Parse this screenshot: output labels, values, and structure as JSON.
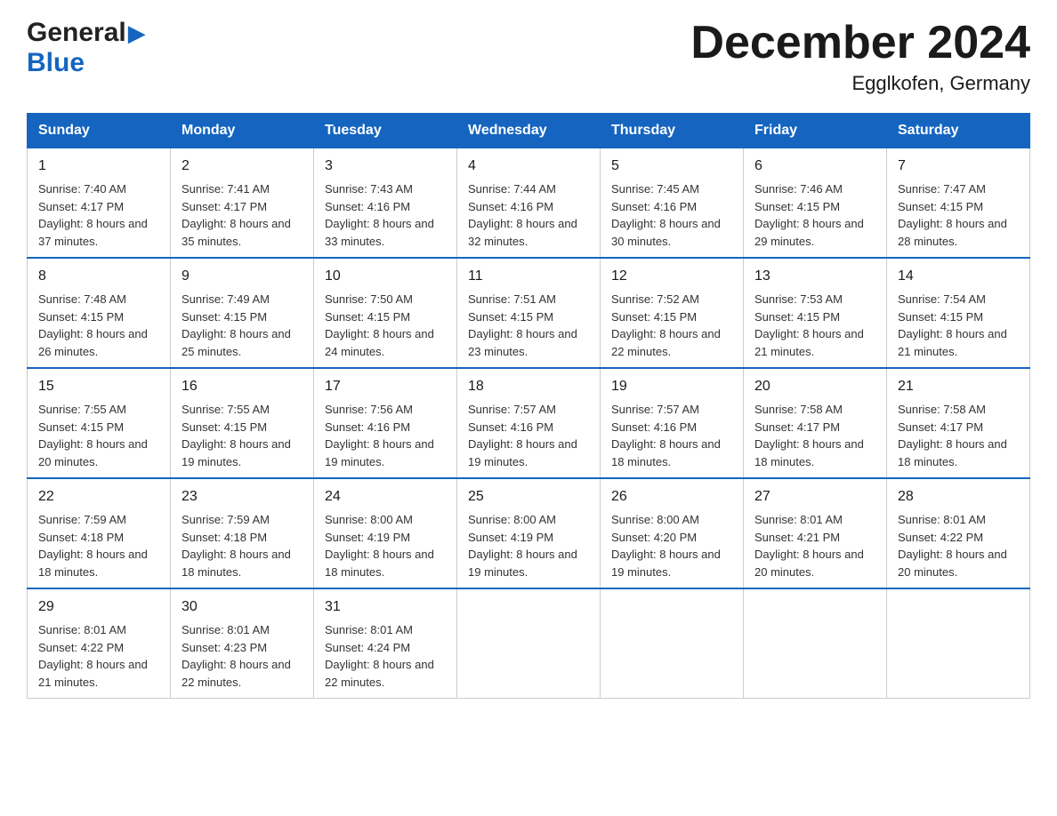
{
  "header": {
    "logo_general": "General",
    "logo_blue": "Blue",
    "month_title": "December 2024",
    "location": "Egglkofen, Germany"
  },
  "days_of_week": [
    "Sunday",
    "Monday",
    "Tuesday",
    "Wednesday",
    "Thursday",
    "Friday",
    "Saturday"
  ],
  "weeks": [
    [
      {
        "day": "1",
        "sunrise": "Sunrise: 7:40 AM",
        "sunset": "Sunset: 4:17 PM",
        "daylight": "Daylight: 8 hours and 37 minutes."
      },
      {
        "day": "2",
        "sunrise": "Sunrise: 7:41 AM",
        "sunset": "Sunset: 4:17 PM",
        "daylight": "Daylight: 8 hours and 35 minutes."
      },
      {
        "day": "3",
        "sunrise": "Sunrise: 7:43 AM",
        "sunset": "Sunset: 4:16 PM",
        "daylight": "Daylight: 8 hours and 33 minutes."
      },
      {
        "day": "4",
        "sunrise": "Sunrise: 7:44 AM",
        "sunset": "Sunset: 4:16 PM",
        "daylight": "Daylight: 8 hours and 32 minutes."
      },
      {
        "day": "5",
        "sunrise": "Sunrise: 7:45 AM",
        "sunset": "Sunset: 4:16 PM",
        "daylight": "Daylight: 8 hours and 30 minutes."
      },
      {
        "day": "6",
        "sunrise": "Sunrise: 7:46 AM",
        "sunset": "Sunset: 4:15 PM",
        "daylight": "Daylight: 8 hours and 29 minutes."
      },
      {
        "day": "7",
        "sunrise": "Sunrise: 7:47 AM",
        "sunset": "Sunset: 4:15 PM",
        "daylight": "Daylight: 8 hours and 28 minutes."
      }
    ],
    [
      {
        "day": "8",
        "sunrise": "Sunrise: 7:48 AM",
        "sunset": "Sunset: 4:15 PM",
        "daylight": "Daylight: 8 hours and 26 minutes."
      },
      {
        "day": "9",
        "sunrise": "Sunrise: 7:49 AM",
        "sunset": "Sunset: 4:15 PM",
        "daylight": "Daylight: 8 hours and 25 minutes."
      },
      {
        "day": "10",
        "sunrise": "Sunrise: 7:50 AM",
        "sunset": "Sunset: 4:15 PM",
        "daylight": "Daylight: 8 hours and 24 minutes."
      },
      {
        "day": "11",
        "sunrise": "Sunrise: 7:51 AM",
        "sunset": "Sunset: 4:15 PM",
        "daylight": "Daylight: 8 hours and 23 minutes."
      },
      {
        "day": "12",
        "sunrise": "Sunrise: 7:52 AM",
        "sunset": "Sunset: 4:15 PM",
        "daylight": "Daylight: 8 hours and 22 minutes."
      },
      {
        "day": "13",
        "sunrise": "Sunrise: 7:53 AM",
        "sunset": "Sunset: 4:15 PM",
        "daylight": "Daylight: 8 hours and 21 minutes."
      },
      {
        "day": "14",
        "sunrise": "Sunrise: 7:54 AM",
        "sunset": "Sunset: 4:15 PM",
        "daylight": "Daylight: 8 hours and 21 minutes."
      }
    ],
    [
      {
        "day": "15",
        "sunrise": "Sunrise: 7:55 AM",
        "sunset": "Sunset: 4:15 PM",
        "daylight": "Daylight: 8 hours and 20 minutes."
      },
      {
        "day": "16",
        "sunrise": "Sunrise: 7:55 AM",
        "sunset": "Sunset: 4:15 PM",
        "daylight": "Daylight: 8 hours and 19 minutes."
      },
      {
        "day": "17",
        "sunrise": "Sunrise: 7:56 AM",
        "sunset": "Sunset: 4:16 PM",
        "daylight": "Daylight: 8 hours and 19 minutes."
      },
      {
        "day": "18",
        "sunrise": "Sunrise: 7:57 AM",
        "sunset": "Sunset: 4:16 PM",
        "daylight": "Daylight: 8 hours and 19 minutes."
      },
      {
        "day": "19",
        "sunrise": "Sunrise: 7:57 AM",
        "sunset": "Sunset: 4:16 PM",
        "daylight": "Daylight: 8 hours and 18 minutes."
      },
      {
        "day": "20",
        "sunrise": "Sunrise: 7:58 AM",
        "sunset": "Sunset: 4:17 PM",
        "daylight": "Daylight: 8 hours and 18 minutes."
      },
      {
        "day": "21",
        "sunrise": "Sunrise: 7:58 AM",
        "sunset": "Sunset: 4:17 PM",
        "daylight": "Daylight: 8 hours and 18 minutes."
      }
    ],
    [
      {
        "day": "22",
        "sunrise": "Sunrise: 7:59 AM",
        "sunset": "Sunset: 4:18 PM",
        "daylight": "Daylight: 8 hours and 18 minutes."
      },
      {
        "day": "23",
        "sunrise": "Sunrise: 7:59 AM",
        "sunset": "Sunset: 4:18 PM",
        "daylight": "Daylight: 8 hours and 18 minutes."
      },
      {
        "day": "24",
        "sunrise": "Sunrise: 8:00 AM",
        "sunset": "Sunset: 4:19 PM",
        "daylight": "Daylight: 8 hours and 18 minutes."
      },
      {
        "day": "25",
        "sunrise": "Sunrise: 8:00 AM",
        "sunset": "Sunset: 4:19 PM",
        "daylight": "Daylight: 8 hours and 19 minutes."
      },
      {
        "day": "26",
        "sunrise": "Sunrise: 8:00 AM",
        "sunset": "Sunset: 4:20 PM",
        "daylight": "Daylight: 8 hours and 19 minutes."
      },
      {
        "day": "27",
        "sunrise": "Sunrise: 8:01 AM",
        "sunset": "Sunset: 4:21 PM",
        "daylight": "Daylight: 8 hours and 20 minutes."
      },
      {
        "day": "28",
        "sunrise": "Sunrise: 8:01 AM",
        "sunset": "Sunset: 4:22 PM",
        "daylight": "Daylight: 8 hours and 20 minutes."
      }
    ],
    [
      {
        "day": "29",
        "sunrise": "Sunrise: 8:01 AM",
        "sunset": "Sunset: 4:22 PM",
        "daylight": "Daylight: 8 hours and 21 minutes."
      },
      {
        "day": "30",
        "sunrise": "Sunrise: 8:01 AM",
        "sunset": "Sunset: 4:23 PM",
        "daylight": "Daylight: 8 hours and 22 minutes."
      },
      {
        "day": "31",
        "sunrise": "Sunrise: 8:01 AM",
        "sunset": "Sunset: 4:24 PM",
        "daylight": "Daylight: 8 hours and 22 minutes."
      },
      null,
      null,
      null,
      null
    ]
  ]
}
